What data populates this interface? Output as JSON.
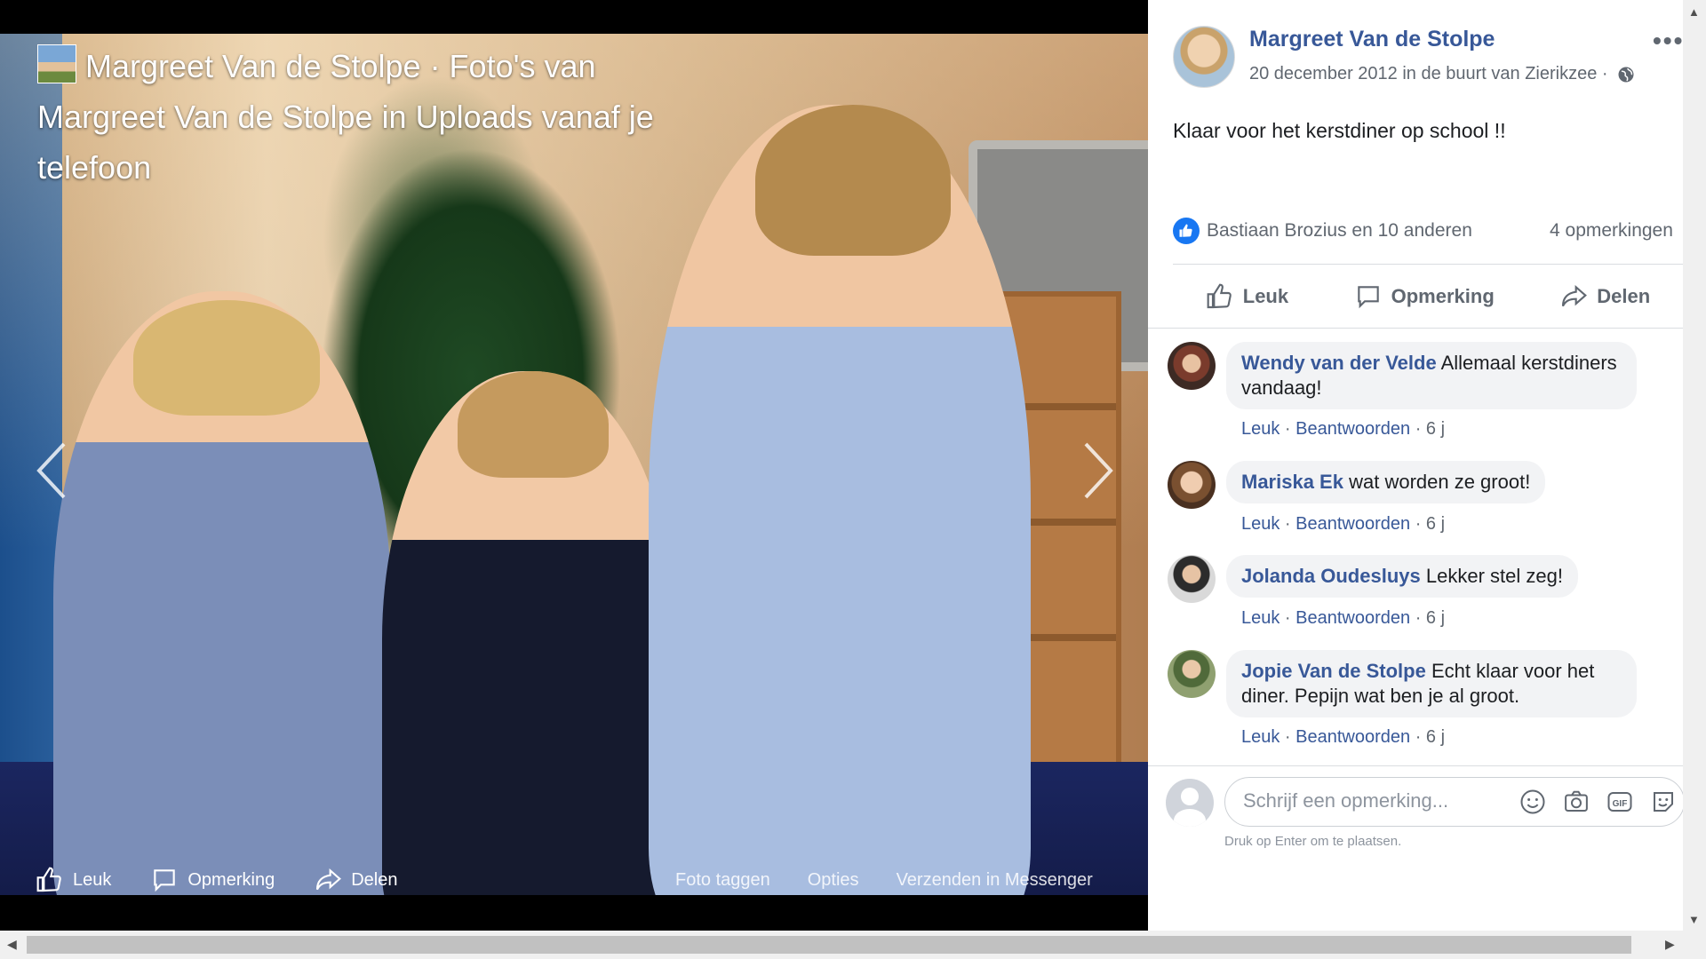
{
  "viewer": {
    "title_line": "Margreet Van de Stolpe · Foto's van Margreet Van de Stolpe in Uploads vanaf je telefoon",
    "actions": [
      {
        "label": "Leuk",
        "icon": "thumbs-up-icon"
      },
      {
        "label": "Opmerking",
        "icon": "comment-icon"
      },
      {
        "label": "Delen",
        "icon": "share-icon"
      }
    ],
    "options": [
      "Foto taggen",
      "Opties",
      "Verzenden in Messenger"
    ]
  },
  "post": {
    "author": "Margreet Van de Stolpe",
    "meta": "20 december 2012 in de buurt van Zierikzee ·",
    "text": "Klaar voor het kerstdiner op school !!",
    "reactions_text": "Bastiaan Brozius en 10 anderen",
    "comments_count": "4 opmerkingen",
    "actions": {
      "like": "Leuk",
      "comment": "Opmerking",
      "share": "Delen"
    },
    "accent_color": "#385898"
  },
  "comments": [
    {
      "name": "Wendy van der Velde",
      "text": "Allemaal kerstdiners vandaag!",
      "like": "Leuk",
      "reply": "Beantwoorden",
      "age": "6 j"
    },
    {
      "name": "Mariska Ek",
      "text": "wat worden ze groot!",
      "like": "Leuk",
      "reply": "Beantwoorden",
      "age": "6 j"
    },
    {
      "name": "Jolanda Oudesluys",
      "text": "Lekker stel zeg!",
      "like": "Leuk",
      "reply": "Beantwoorden",
      "age": "6 j"
    },
    {
      "name": "Jopie Van de Stolpe",
      "text": "Echt klaar voor het diner. Pepijn wat ben je al groot.",
      "like": "Leuk",
      "reply": "Beantwoorden",
      "age": "6 j"
    }
  ],
  "compose": {
    "placeholder": "Schrijf een opmerking...",
    "hint": "Druk op Enter om te plaatsen.",
    "icons": [
      "emoji-icon",
      "camera-icon",
      "gif-icon",
      "sticker-icon"
    ]
  }
}
